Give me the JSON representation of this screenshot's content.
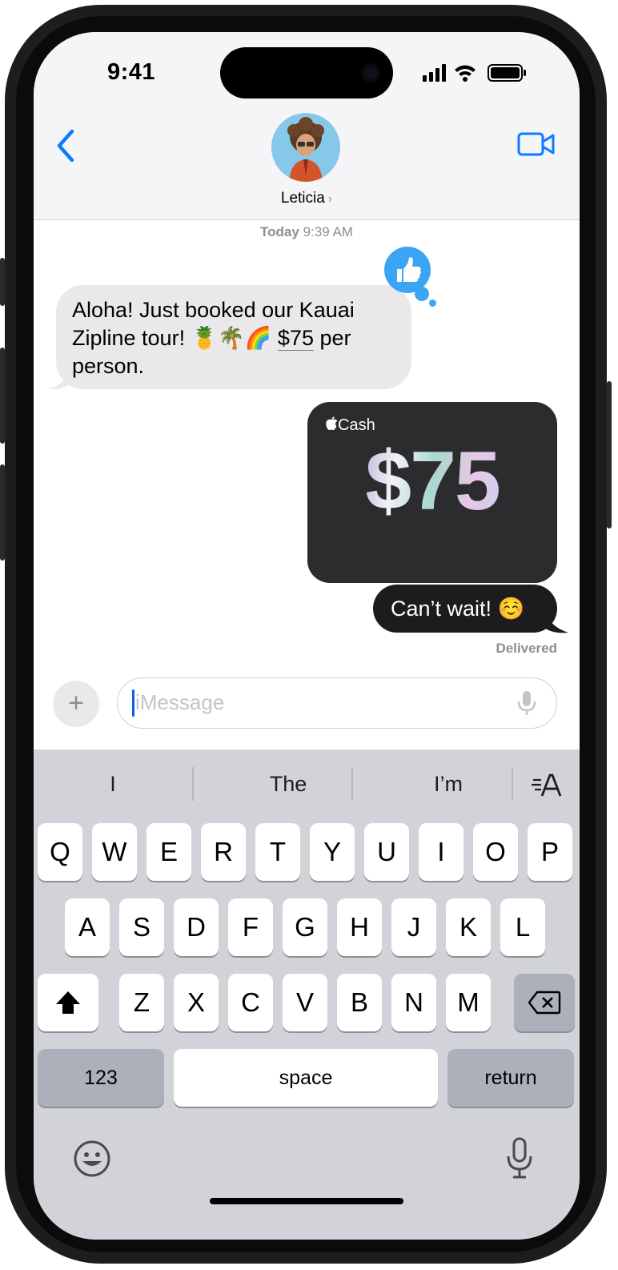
{
  "status_bar": {
    "time": "9:41"
  },
  "header": {
    "contact_name": "Leticia",
    "chevron": "›"
  },
  "thread": {
    "timestamp_day": "Today",
    "timestamp_time": "9:39 AM",
    "incoming_line1": "Aloha! Just booked our Kauai",
    "incoming_line2_pre": "Zipline tour! 🍍🌴🌈 ",
    "incoming_amount": "$75",
    "incoming_line2_post": " per",
    "incoming_line3": "person.",
    "cash_brand": "Cash",
    "cash_amount": "$75",
    "outgoing_message": "Can’t wait! ☺️",
    "delivered_label": "Delivered"
  },
  "composer": {
    "plus_label": "+",
    "placeholder": "iMessage"
  },
  "keyboard": {
    "predictions": [
      "I",
      "The",
      "I’m"
    ],
    "row1": [
      "Q",
      "W",
      "E",
      "R",
      "T",
      "Y",
      "U",
      "I",
      "O",
      "P"
    ],
    "row2": [
      "A",
      "S",
      "D",
      "F",
      "G",
      "H",
      "J",
      "K",
      "L"
    ],
    "row3": [
      "Z",
      "X",
      "C",
      "V",
      "B",
      "N",
      "M"
    ],
    "numbers_label": "123",
    "space_label": "space",
    "return_label": "return"
  },
  "colors": {
    "accent": "#0a7cff",
    "tapback": "#3ba4f5",
    "outgoing_bubble": "#1c1c1e",
    "incoming_bubble": "#e9e9eb",
    "keyboard_bg": "#d1d3d9"
  },
  "icons": [
    "back-chevron-icon",
    "video-camera-icon",
    "thumbs-up-icon",
    "apple-logo-icon",
    "microphone-icon",
    "shift-icon",
    "delete-icon",
    "emoji-icon",
    "dictation-icon",
    "format-text-icon"
  ]
}
